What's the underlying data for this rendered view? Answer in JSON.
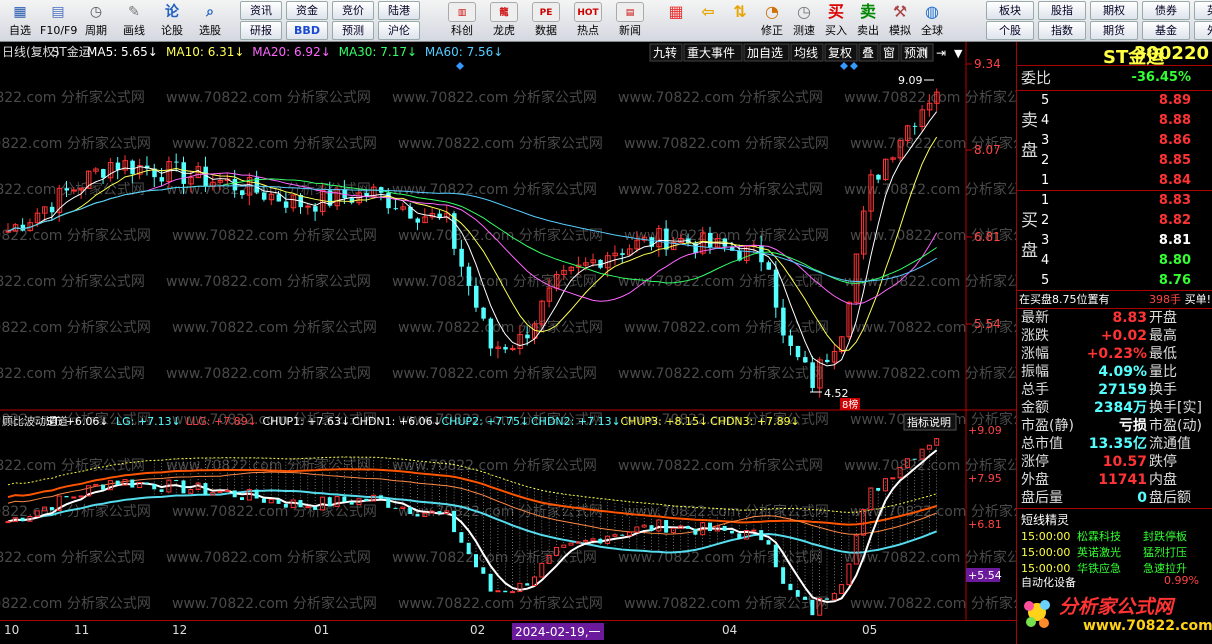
{
  "toolbar": {
    "items": [
      {
        "label": "自选",
        "icon": "grid-icon",
        "color": "#2a5db0",
        "glyph": "▦"
      },
      {
        "label": "F10/F9",
        "icon": "f10-icon",
        "color": "#4a6fc0",
        "glyph": "▤"
      },
      {
        "label": "周期",
        "icon": "clock-icon",
        "color": "#555",
        "glyph": "◷"
      },
      {
        "label": "画线",
        "icon": "pencil-icon",
        "color": "#777",
        "glyph": "✎"
      },
      {
        "label": "论股",
        "icon": "talk-icon",
        "color": "#2060c0",
        "glyph": "论"
      },
      {
        "label": "选股",
        "icon": "magnifier-icon",
        "color": "#2060c0",
        "glyph": "⌕"
      }
    ],
    "small_row1": [
      "资讯",
      "资金",
      "竞价",
      "陆港"
    ],
    "small_row2": [
      "研报",
      "BBD",
      "预测",
      "沪伦"
    ],
    "icons2": [
      {
        "label": "科创",
        "icon": "chart-icon",
        "glyph": "▥"
      },
      {
        "label": "龙虎",
        "icon": "dragon-icon",
        "glyph": "龍"
      },
      {
        "label": "数据",
        "icon": "pe-icon",
        "glyph": "PE"
      },
      {
        "label": "热点",
        "icon": "hot-icon",
        "glyph": "HOT"
      },
      {
        "label": "新闻",
        "icon": "news-icon",
        "glyph": "▤"
      }
    ],
    "icons3": [
      {
        "label": "",
        "icon": "color-grid-icon",
        "glyph": "▦"
      },
      {
        "label": "",
        "icon": "back-arrow-icon",
        "glyph": "⇦"
      },
      {
        "label": "",
        "icon": "up-down-icon",
        "glyph": "⇅"
      },
      {
        "label": "修正",
        "icon": "fix-icon",
        "glyph": "◔"
      },
      {
        "label": "测速",
        "icon": "speed-icon",
        "glyph": "◷"
      },
      {
        "label": "买入",
        "icon": "buy-icon",
        "glyph": "买"
      },
      {
        "label": "卖出",
        "icon": "sell-icon",
        "glyph": "卖"
      },
      {
        "label": "模拟",
        "icon": "hammer-icon",
        "glyph": "⚒"
      },
      {
        "label": "全球",
        "icon": "globe-icon",
        "glyph": "◍"
      }
    ],
    "right_row1": [
      "板块",
      "股指",
      "期权",
      "债券",
      "英股"
    ],
    "right_row2": [
      "个股",
      "指数",
      "期货",
      "基金",
      "外汇"
    ]
  },
  "chart": {
    "top_legend": {
      "title": "日线(复权)",
      "name": "ST金运",
      "ma5": "MA5: 5.65↓",
      "ma10": "MA10: 6.31↓",
      "ma20": "MA20: 6.92↓",
      "ma30": "MA30: 7.17↓",
      "ma60": "MA60: 7.56↓"
    },
    "top_buttons": [
      "九转",
      "重大事件",
      "加自选",
      "均线",
      "复权",
      "叠",
      "窗",
      "预测"
    ],
    "price_axis": [
      "9.34",
      "8.07",
      "6.81",
      "5.54"
    ],
    "high_label": "9.09",
    "low_label": "4.52",
    "tag_label": "8榜",
    "indicator_legend": {
      "name": "顾比波动通道",
      "st": "ST: +6.06↓",
      "lg": "LG: +7.13↓",
      "llg": "LLG: +7.89↓",
      "chup1": "CHUP1: +7.63↓",
      "chdn1": "CHDN1: +6.06↓",
      "chup2": "CHUP2: +7.75↓",
      "chdn2": "CHDN2: +7.13↓",
      "chup3": "CHUP3: +8.15↓",
      "chdn3": "CHDN3: +7.89↓"
    },
    "indicator_button": "指标说明",
    "indicator_axis": [
      "+9.09",
      "+7.95",
      "+6.81",
      "+5.54"
    ],
    "watermark": "www.70822.com 分析家公式网",
    "time_labels": [
      "10",
      "11",
      "12",
      "01",
      "02",
      "2024-02-19,一",
      "04",
      "05"
    ]
  },
  "sidebar": {
    "stock_name": "ST金运",
    "stock_code": "300220",
    "weibi_label": "委比",
    "weibi_value": "-36.45%",
    "sell_label_top": "卖",
    "sell_label_bottom": "盘",
    "buy_label_top": "买",
    "buy_label_bottom": "盘",
    "asks": [
      {
        "n": "5",
        "p": "8.89"
      },
      {
        "n": "4",
        "p": "8.88"
      },
      {
        "n": "3",
        "p": "8.86"
      },
      {
        "n": "2",
        "p": "8.85"
      },
      {
        "n": "1",
        "p": "8.84"
      }
    ],
    "bids": [
      {
        "n": "1",
        "p": "8.83"
      },
      {
        "n": "2",
        "p": "8.82"
      },
      {
        "n": "3",
        "p": "8.81"
      },
      {
        "n": "4",
        "p": "8.80"
      },
      {
        "n": "5",
        "p": "8.76"
      }
    ],
    "bidinfo": {
      "text": "在买盘8.75位置有",
      "qty": "398手",
      "action": "买单!"
    },
    "stats": [
      {
        "l": "最新",
        "v": "8.83",
        "vc": "red",
        "r": "开盘"
      },
      {
        "l": "涨跌",
        "v": "+0.02",
        "vc": "red",
        "r": "最高"
      },
      {
        "l": "涨幅",
        "v": "+0.23%",
        "vc": "red",
        "r": "最低"
      },
      {
        "l": "振幅",
        "v": "4.09%",
        "vc": "cyan",
        "r": "量比"
      },
      {
        "l": "总手",
        "v": "27159",
        "vc": "cyan",
        "r": "换手"
      },
      {
        "l": "金额",
        "v": "2384万",
        "vc": "cyan",
        "r": "换手[实]"
      },
      {
        "l": "市盈(静)",
        "v": "亏损",
        "vc": "white",
        "r": "市盈(动)"
      },
      {
        "l": "总市值",
        "v": "13.35亿",
        "vc": "cyan",
        "r": "流通值"
      },
      {
        "l": "涨停",
        "v": "10.57",
        "vc": "red",
        "r": "跌停"
      },
      {
        "l": "外盘",
        "v": "11741",
        "vc": "red",
        "r": "内盘"
      },
      {
        "l": "盘后量",
        "v": "0",
        "vc": "cyan",
        "r": "盘后额"
      }
    ],
    "news_title": "短线精灵",
    "news": [
      {
        "t": "15:00:00",
        "n": "松霖科技",
        "e": "封跌停板"
      },
      {
        "t": "15:00:00",
        "n": "英诺激光",
        "e": "猛烈打压"
      },
      {
        "t": "15:00:00",
        "n": "华铁应急",
        "e": "急速拉升"
      }
    ],
    "footer_left": "自动化设备",
    "footer_right": "0.99%",
    "logo_text": "分析家公式网",
    "logo_url": "www.70822.com"
  },
  "colors": {
    "up": "#ff3333",
    "down": "#55ffff",
    "ma5": "#ffffff",
    "ma10": "#ffff55",
    "ma20": "#ff66ff",
    "ma30": "#33ff66",
    "ma60": "#55ccff"
  }
}
